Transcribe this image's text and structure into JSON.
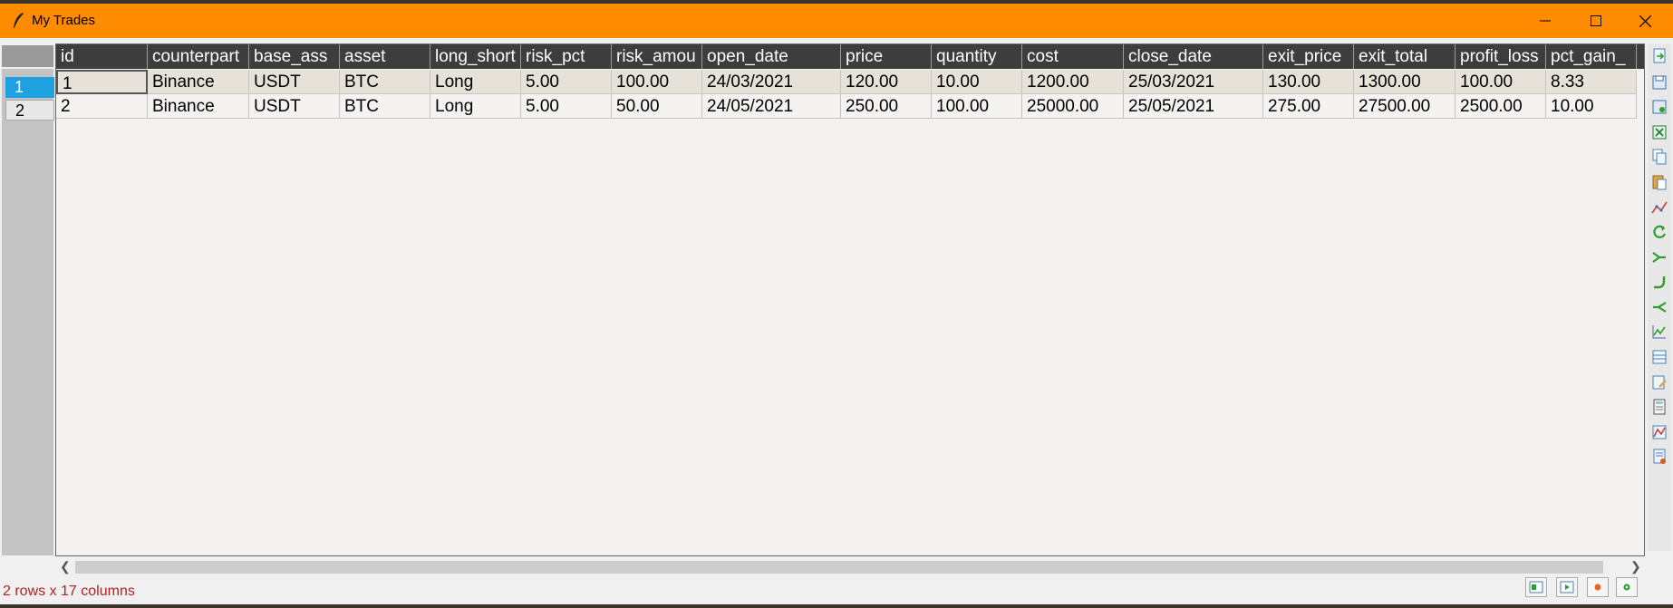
{
  "window": {
    "title": "My Trades"
  },
  "columns": [
    "id",
    "counterpart",
    "base_ass",
    "asset",
    "long_short",
    "risk_pct",
    "risk_amou",
    "open_date",
    "price",
    "quantity",
    "cost",
    "close_date",
    "exit_price",
    "exit_total",
    "profit_loss",
    "pct_gain_"
  ],
  "row_headers": [
    "1",
    "2"
  ],
  "rows": [
    [
      "1",
      "Binance",
      "USDT",
      "BTC",
      "Long",
      "5.00",
      "100.00",
      "24/03/2021",
      "120.00",
      "10.00",
      "1200.00",
      "25/03/2021",
      "130.00",
      "1300.00",
      "100.00",
      "8.33"
    ],
    [
      "2",
      "Binance",
      "USDT",
      "BTC",
      "Long",
      "5.00",
      "50.00",
      "24/05/2021",
      "250.00",
      "100.00",
      "25000.00",
      "25/05/2021",
      "275.00",
      "27500.00",
      "2500.00",
      "10.00"
    ]
  ],
  "status": "2 rows x 17 columns",
  "colors": {
    "title_bar": "#ff8c00",
    "header_bg": "#3d3d3d",
    "selected_row": "#1da1e0",
    "status_text": "#b22222"
  },
  "icons": {
    "window": [
      "feather-icon",
      "minimize-icon",
      "maximize-icon",
      "close-icon"
    ],
    "toolbar": [
      "import-icon",
      "save-icon",
      "save-as-icon",
      "excel-icon",
      "copy-icon",
      "paste-icon",
      "plot-icon",
      "transpose-icon",
      "merge-icon",
      "pivot-icon",
      "aggregate-icon",
      "chart-icon",
      "table-icon",
      "edit-icon",
      "calculator-icon",
      "graph-icon",
      "report-icon"
    ],
    "bottom": [
      "add-row-icon",
      "add-column-icon",
      "delete-icon",
      "settings-icon"
    ]
  }
}
